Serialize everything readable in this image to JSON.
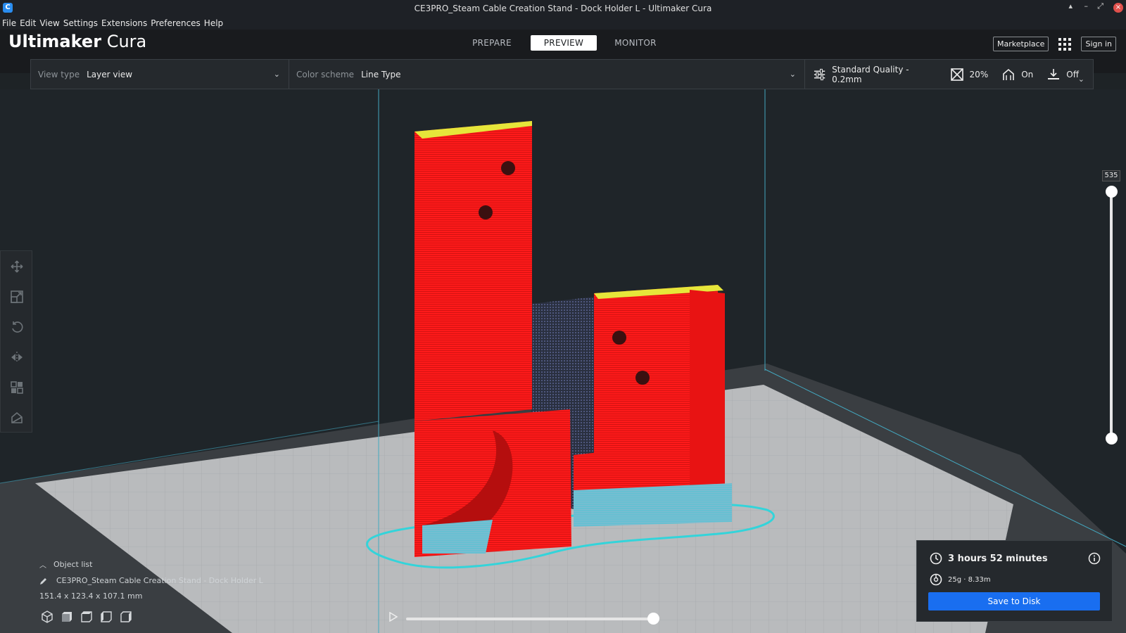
{
  "window": {
    "title": "CE3PRO_Steam Cable Creation Stand - Dock Holder L - Ultimaker Cura"
  },
  "menu": [
    "File",
    "Edit",
    "View",
    "Settings",
    "Extensions",
    "Preferences",
    "Help"
  ],
  "brand": {
    "bold": "Ultimaker",
    "light": "Cura"
  },
  "stages": [
    {
      "label": "PREPARE",
      "active": false
    },
    {
      "label": "PREVIEW",
      "active": true
    },
    {
      "label": "MONITOR",
      "active": false
    }
  ],
  "header_right": {
    "marketplace": "Marketplace",
    "signin": "Sign in"
  },
  "toolbar": {
    "view_type_label": "View type",
    "view_type_value": "Layer view",
    "color_scheme_label": "Color scheme",
    "color_scheme_value": "Line Type",
    "quality": "Standard Quality - 0.2mm",
    "infill": "20%",
    "support": "On",
    "adhesion": "Off"
  },
  "layer_slider": {
    "max_label": "535"
  },
  "object_list": {
    "header": "Object list",
    "object_name": "CE3PRO_Steam Cable Creation Stand - Dock Holder L",
    "dimensions": "151.4 x 123.4 x 107.1 mm"
  },
  "print_info": {
    "time": "3 hours 52 minutes",
    "material": "25g · 8.33m",
    "save_label": "Save to Disk"
  },
  "icons": {
    "tools": [
      "move-icon",
      "scale-icon",
      "rotate-icon",
      "mirror-icon",
      "per-model-settings-icon",
      "support-blocker-icon"
    ],
    "views": [
      "3d-view-icon",
      "front-view-icon",
      "top-view-icon",
      "left-view-icon",
      "right-view-icon"
    ]
  },
  "colors": {
    "accent": "#196ef0",
    "model_wall": "#ff1a1a",
    "skin": "#ffff00",
    "support": "#33cccc"
  }
}
